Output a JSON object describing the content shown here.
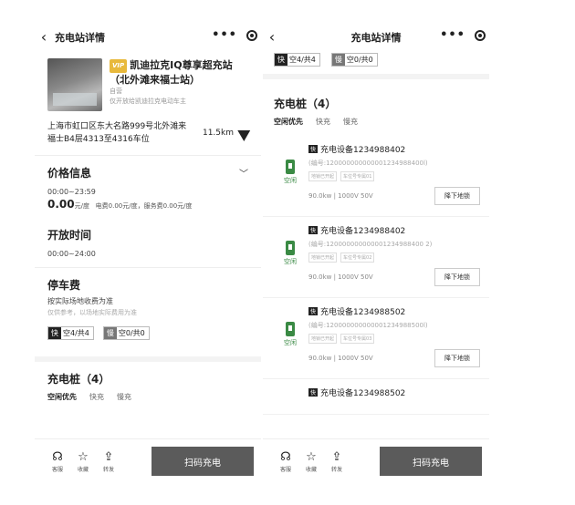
{
  "left": {
    "nav": {
      "back": "‹",
      "title": "充电站详情"
    },
    "station": {
      "vip": "VIP",
      "name_line1": "凯迪拉克IQ尊享超充站",
      "name_line2": "（北外滩来福士站）",
      "self": "自营",
      "note": "仅开放给凯迪拉克电动车主"
    },
    "address": {
      "line1": "上海市虹口区东大名路999号北外滩来",
      "line2": "福士B4层4313至4316车位",
      "distance": "11.5km"
    },
    "price": {
      "title": "价格信息",
      "time": "00:00~23:59",
      "amount": "0.00",
      "unit": "元/度",
      "detail": "电费0.00元/度，服务费0.00元/度"
    },
    "open": {
      "title": "开放时间",
      "time": "00:00~24:00"
    },
    "parking": {
      "title": "停车费",
      "desc": "按实际场地收费为准",
      "note": "仅供参考，以场地实际费用为准"
    },
    "badges": {
      "fast_tag": "快",
      "fast_count": "空4/共4",
      "slow_tag": "慢",
      "slow_count": "空0/共0"
    },
    "piles": {
      "title": "充电桩（4）",
      "filter1": "空闲优先",
      "filter2": "快充",
      "filter3": "慢充"
    },
    "bottom": {
      "service": "客服",
      "favorite": "收藏",
      "share": "转发",
      "scan": "扫码充电"
    }
  },
  "right": {
    "nav": {
      "back": "‹",
      "title": "充电站详情"
    },
    "badges": {
      "fast_tag": "快",
      "fast_count": "空4/共4",
      "slow_tag": "慢",
      "slow_count": "空0/共0"
    },
    "piles": {
      "title": "充电桩（4）",
      "filter1": "空闲优先",
      "filter2": "快充",
      "filter3": "慢充"
    },
    "devices": [
      {
        "tag": "快",
        "name": "充电设备1234988402",
        "code": "(编号:120000000000001234988400l)",
        "chip1": "地锁已开起",
        "chip2": "车位号专属01",
        "status": "空闲",
        "power": "90.0kw | 1000V 50V",
        "button": "降下地锁"
      },
      {
        "tag": "快",
        "name": "充电设备1234988402",
        "code": "(编号:120000000000001234988400 2)",
        "chip1": "地锁已开起",
        "chip2": "车位号专属02",
        "status": "空闲",
        "power": "90.0kw | 1000V 50V",
        "button": "降下地锁"
      },
      {
        "tag": "快",
        "name": "充电设备1234988502",
        "code": "(编号:120000000000001234988500l)",
        "chip1": "地锁已开起",
        "chip2": "车位号专属03",
        "status": "空闲",
        "power": "90.0kw | 1000V 50V",
        "button": "降下地锁"
      },
      {
        "tag": "快",
        "name": "充电设备1234988502"
      }
    ],
    "bottom": {
      "service": "客服",
      "favorite": "收藏",
      "share": "转发",
      "scan": "扫码充电"
    }
  }
}
